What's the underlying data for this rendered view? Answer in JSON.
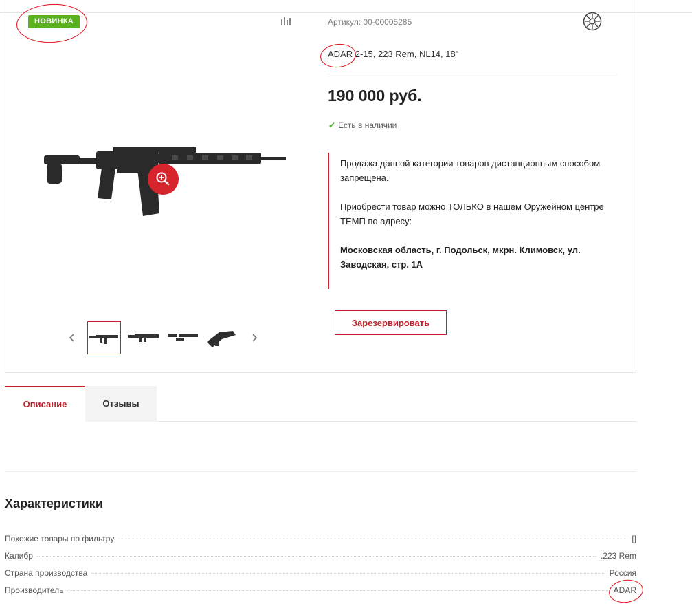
{
  "product": {
    "badge": "НОВИНКА",
    "sku_label": "Артикул:",
    "sku_value": "00-00005285",
    "title": "ADAR 2-15, 223 Rem,  NL14, 18\"",
    "price": "190 000 руб.",
    "stock": "Есть в наличии",
    "reserve_button": "Зарезервировать"
  },
  "notice": {
    "line1": "Продажа данной категории товаров дистанционным способом запрещена.",
    "line2": "Приобрести товар можно ТОЛЬКО в нашем Оружейном центре ТЕМП по адресу:",
    "address": "Московская область, г. Подольск, мкрн. Климовск, ул. Заводская, стр. 1А"
  },
  "tabs": [
    {
      "label": "Описание",
      "active": true
    },
    {
      "label": "Отзывы",
      "active": false
    }
  ],
  "characteristics": {
    "title": "Характеристики",
    "rows": [
      {
        "name": "Похожие товары по фильтру",
        "value": "[]"
      },
      {
        "name": "Калибр",
        "value": ".223 Rem"
      },
      {
        "name": "Страна производства",
        "value": "Россия"
      },
      {
        "name": "Производитель",
        "value": "ADAR"
      }
    ]
  },
  "icons": {
    "compare": "bar-chart-icon",
    "zoom": "zoom-in-icon",
    "brand": "brand-logo-icon",
    "prev": "chevron-left-icon",
    "next": "chevron-right-icon",
    "stock": "check-icon"
  },
  "colors": {
    "accent": "#c2202a",
    "badge": "#5ab21f",
    "zoom": "#d7252e",
    "stock": "#4fae3a",
    "annotation": "#e0101a"
  }
}
